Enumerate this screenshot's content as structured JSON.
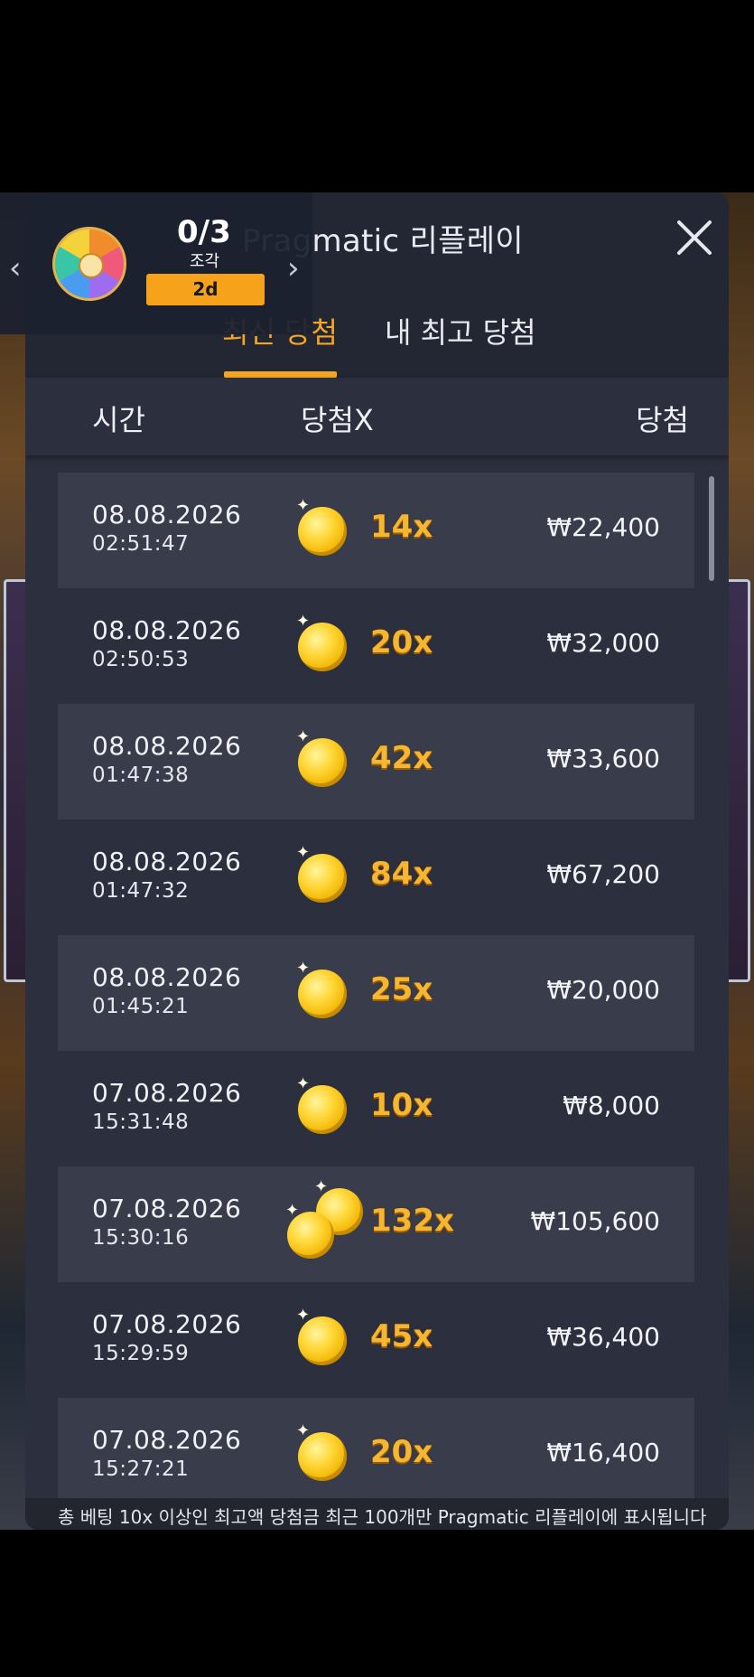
{
  "header": {
    "title": "Pragmatic 리플레이",
    "close_label": "✕"
  },
  "tabs": [
    {
      "label": "최신 당첨",
      "active": true
    },
    {
      "label": "내 최고 당첨",
      "active": false
    }
  ],
  "columns": {
    "time": "시간",
    "multiplier": "당첨X",
    "win": "당첨"
  },
  "rows": [
    {
      "date": "08.08.2026",
      "time": "02:51:47",
      "multiplier": "14x",
      "amount": "₩22,400",
      "coins": 1
    },
    {
      "date": "08.08.2026",
      "time": "02:50:53",
      "multiplier": "20x",
      "amount": "₩32,000",
      "coins": 1
    },
    {
      "date": "08.08.2026",
      "time": "01:47:38",
      "multiplier": "42x",
      "amount": "₩33,600",
      "coins": 1
    },
    {
      "date": "08.08.2026",
      "time": "01:47:32",
      "multiplier": "84x",
      "amount": "₩67,200",
      "coins": 1
    },
    {
      "date": "08.08.2026",
      "time": "01:45:21",
      "multiplier": "25x",
      "amount": "₩20,000",
      "coins": 1
    },
    {
      "date": "07.08.2026",
      "time": "15:31:48",
      "multiplier": "10x",
      "amount": "₩8,000",
      "coins": 1
    },
    {
      "date": "07.08.2026",
      "time": "15:30:16",
      "multiplier": "132x",
      "amount": "₩105,600",
      "coins": 2
    },
    {
      "date": "07.08.2026",
      "time": "15:29:59",
      "multiplier": "45x",
      "amount": "₩36,400",
      "coins": 1
    },
    {
      "date": "07.08.2026",
      "time": "15:27:21",
      "multiplier": "20x",
      "amount": "₩16,400",
      "coins": 1
    }
  ],
  "footer": {
    "note": "총 베팅 10x 이상인 최고액 당첨금 최근 100개만 Pragmatic 리플레이에 표시됩니다"
  },
  "widget": {
    "count": "0/3",
    "label": "조각",
    "badge": "2d",
    "prev": "‹",
    "next": "›"
  },
  "colors": {
    "accent": "#f5a623",
    "panel": "#2c2f3d",
    "row_alt": "#393c4a"
  },
  "icons": [
    "close-icon",
    "coin-icon",
    "wheel-icon",
    "chevron-left-icon",
    "chevron-right-icon"
  ]
}
